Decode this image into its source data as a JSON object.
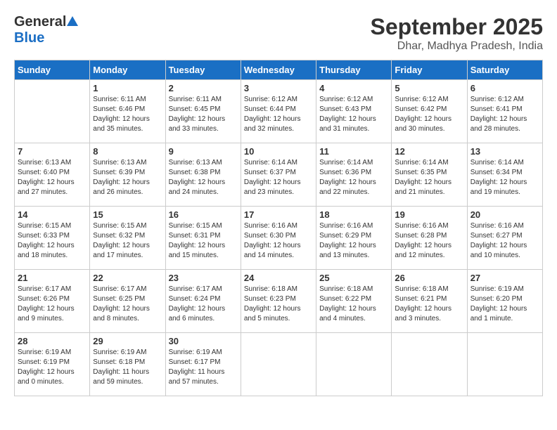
{
  "logo": {
    "general": "General",
    "blue": "Blue"
  },
  "header": {
    "month": "September 2025",
    "location": "Dhar, Madhya Pradesh, India"
  },
  "weekdays": [
    "Sunday",
    "Monday",
    "Tuesday",
    "Wednesday",
    "Thursday",
    "Friday",
    "Saturday"
  ],
  "weeks": [
    [
      {
        "day": "",
        "info": ""
      },
      {
        "day": "1",
        "info": "Sunrise: 6:11 AM\nSunset: 6:46 PM\nDaylight: 12 hours\nand 35 minutes."
      },
      {
        "day": "2",
        "info": "Sunrise: 6:11 AM\nSunset: 6:45 PM\nDaylight: 12 hours\nand 33 minutes."
      },
      {
        "day": "3",
        "info": "Sunrise: 6:12 AM\nSunset: 6:44 PM\nDaylight: 12 hours\nand 32 minutes."
      },
      {
        "day": "4",
        "info": "Sunrise: 6:12 AM\nSunset: 6:43 PM\nDaylight: 12 hours\nand 31 minutes."
      },
      {
        "day": "5",
        "info": "Sunrise: 6:12 AM\nSunset: 6:42 PM\nDaylight: 12 hours\nand 30 minutes."
      },
      {
        "day": "6",
        "info": "Sunrise: 6:12 AM\nSunset: 6:41 PM\nDaylight: 12 hours\nand 28 minutes."
      }
    ],
    [
      {
        "day": "7",
        "info": "Sunrise: 6:13 AM\nSunset: 6:40 PM\nDaylight: 12 hours\nand 27 minutes."
      },
      {
        "day": "8",
        "info": "Sunrise: 6:13 AM\nSunset: 6:39 PM\nDaylight: 12 hours\nand 26 minutes."
      },
      {
        "day": "9",
        "info": "Sunrise: 6:13 AM\nSunset: 6:38 PM\nDaylight: 12 hours\nand 24 minutes."
      },
      {
        "day": "10",
        "info": "Sunrise: 6:14 AM\nSunset: 6:37 PM\nDaylight: 12 hours\nand 23 minutes."
      },
      {
        "day": "11",
        "info": "Sunrise: 6:14 AM\nSunset: 6:36 PM\nDaylight: 12 hours\nand 22 minutes."
      },
      {
        "day": "12",
        "info": "Sunrise: 6:14 AM\nSunset: 6:35 PM\nDaylight: 12 hours\nand 21 minutes."
      },
      {
        "day": "13",
        "info": "Sunrise: 6:14 AM\nSunset: 6:34 PM\nDaylight: 12 hours\nand 19 minutes."
      }
    ],
    [
      {
        "day": "14",
        "info": "Sunrise: 6:15 AM\nSunset: 6:33 PM\nDaylight: 12 hours\nand 18 minutes."
      },
      {
        "day": "15",
        "info": "Sunrise: 6:15 AM\nSunset: 6:32 PM\nDaylight: 12 hours\nand 17 minutes."
      },
      {
        "day": "16",
        "info": "Sunrise: 6:15 AM\nSunset: 6:31 PM\nDaylight: 12 hours\nand 15 minutes."
      },
      {
        "day": "17",
        "info": "Sunrise: 6:16 AM\nSunset: 6:30 PM\nDaylight: 12 hours\nand 14 minutes."
      },
      {
        "day": "18",
        "info": "Sunrise: 6:16 AM\nSunset: 6:29 PM\nDaylight: 12 hours\nand 13 minutes."
      },
      {
        "day": "19",
        "info": "Sunrise: 6:16 AM\nSunset: 6:28 PM\nDaylight: 12 hours\nand 12 minutes."
      },
      {
        "day": "20",
        "info": "Sunrise: 6:16 AM\nSunset: 6:27 PM\nDaylight: 12 hours\nand 10 minutes."
      }
    ],
    [
      {
        "day": "21",
        "info": "Sunrise: 6:17 AM\nSunset: 6:26 PM\nDaylight: 12 hours\nand 9 minutes."
      },
      {
        "day": "22",
        "info": "Sunrise: 6:17 AM\nSunset: 6:25 PM\nDaylight: 12 hours\nand 8 minutes."
      },
      {
        "day": "23",
        "info": "Sunrise: 6:17 AM\nSunset: 6:24 PM\nDaylight: 12 hours\nand 6 minutes."
      },
      {
        "day": "24",
        "info": "Sunrise: 6:18 AM\nSunset: 6:23 PM\nDaylight: 12 hours\nand 5 minutes."
      },
      {
        "day": "25",
        "info": "Sunrise: 6:18 AM\nSunset: 6:22 PM\nDaylight: 12 hours\nand 4 minutes."
      },
      {
        "day": "26",
        "info": "Sunrise: 6:18 AM\nSunset: 6:21 PM\nDaylight: 12 hours\nand 3 minutes."
      },
      {
        "day": "27",
        "info": "Sunrise: 6:19 AM\nSunset: 6:20 PM\nDaylight: 12 hours\nand 1 minute."
      }
    ],
    [
      {
        "day": "28",
        "info": "Sunrise: 6:19 AM\nSunset: 6:19 PM\nDaylight: 12 hours\nand 0 minutes."
      },
      {
        "day": "29",
        "info": "Sunrise: 6:19 AM\nSunset: 6:18 PM\nDaylight: 11 hours\nand 59 minutes."
      },
      {
        "day": "30",
        "info": "Sunrise: 6:19 AM\nSunset: 6:17 PM\nDaylight: 11 hours\nand 57 minutes."
      },
      {
        "day": "",
        "info": ""
      },
      {
        "day": "",
        "info": ""
      },
      {
        "day": "",
        "info": ""
      },
      {
        "day": "",
        "info": ""
      }
    ]
  ]
}
